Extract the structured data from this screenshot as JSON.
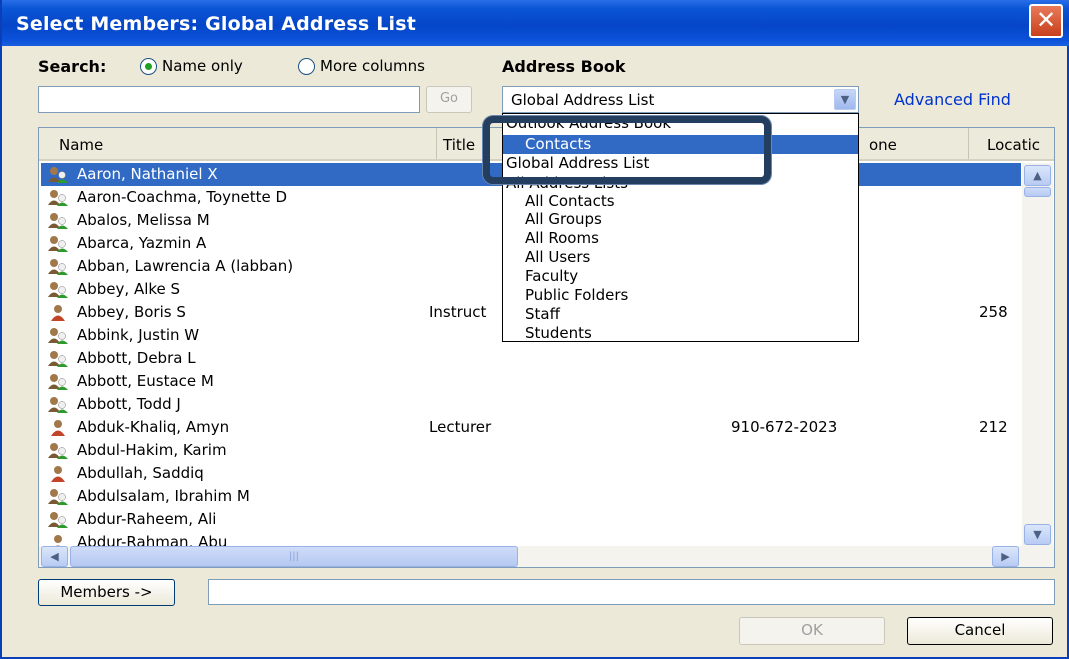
{
  "window": {
    "title": "Select Members: Global Address List",
    "close_label": "✕"
  },
  "search": {
    "label": "Search:",
    "options": [
      {
        "label": "Name only",
        "selected": true
      },
      {
        "label": "More columns",
        "selected": false
      }
    ],
    "value": "",
    "go_label": "Go"
  },
  "address_book": {
    "label": "Address Book",
    "selected": "Global Address List",
    "advanced_find": "Advanced Find",
    "options": [
      {
        "label": "Outlook Address Book",
        "indent": false,
        "highlighted": false
      },
      {
        "label": "Contacts",
        "indent": true,
        "highlighted": true
      },
      {
        "label": "Global Address List",
        "indent": false,
        "highlighted": false
      },
      {
        "label": "All Address Lists",
        "indent": false,
        "highlighted": false
      },
      {
        "label": "All Contacts",
        "indent": true,
        "highlighted": false
      },
      {
        "label": "All Groups",
        "indent": true,
        "highlighted": false
      },
      {
        "label": "All Rooms",
        "indent": true,
        "highlighted": false
      },
      {
        "label": "All Users",
        "indent": true,
        "highlighted": false
      },
      {
        "label": "Faculty",
        "indent": true,
        "highlighted": false
      },
      {
        "label": "Public Folders",
        "indent": true,
        "highlighted": false
      },
      {
        "label": "Staff",
        "indent": true,
        "highlighted": false
      },
      {
        "label": "Students",
        "indent": true,
        "highlighted": false
      }
    ]
  },
  "table": {
    "columns": [
      "Name",
      "Title",
      "one",
      "Locatic"
    ],
    "rows": [
      {
        "name": "Aaron, Nathaniel X",
        "title": "",
        "phone": "",
        "location": "",
        "icon": "contact-group",
        "selected": true
      },
      {
        "name": "Aaron-Coachma, Toynette D",
        "title": "",
        "phone": "",
        "location": "",
        "icon": "contact-group"
      },
      {
        "name": "Abalos, Melissa M",
        "title": "",
        "phone": "",
        "location": "",
        "icon": "contact-group"
      },
      {
        "name": "Abarca, Yazmin A",
        "title": "",
        "phone": "",
        "location": "",
        "icon": "contact-group"
      },
      {
        "name": "Abban, Lawrencia A (labban)",
        "title": "",
        "phone": "",
        "location": "",
        "icon": "contact-group"
      },
      {
        "name": "Abbey, Alke S",
        "title": "",
        "phone": "",
        "location": "",
        "icon": "contact-group"
      },
      {
        "name": "Abbey, Boris S",
        "title": "Instruct",
        "phone": "",
        "location": "258",
        "icon": "contact-person"
      },
      {
        "name": "Abbink, Justin W",
        "title": "",
        "phone": "",
        "location": "",
        "icon": "contact-group"
      },
      {
        "name": "Abbott, Debra L",
        "title": "",
        "phone": "",
        "location": "",
        "icon": "contact-group"
      },
      {
        "name": "Abbott, Eustace M",
        "title": "",
        "phone": "",
        "location": "",
        "icon": "contact-group"
      },
      {
        "name": "Abbott, Todd J",
        "title": "",
        "phone": "",
        "location": "",
        "icon": "contact-group"
      },
      {
        "name": "Abduk-Khaliq, Amyn",
        "title": "Lecturer",
        "phone": "910-672-2023",
        "location": "212",
        "icon": "contact-person"
      },
      {
        "name": "Abdul-Hakim, Karim",
        "title": "",
        "phone": "",
        "location": "",
        "icon": "contact-group"
      },
      {
        "name": "Abdullah, Saddiq",
        "title": "",
        "phone": "",
        "location": "",
        "icon": "contact-person"
      },
      {
        "name": "Abdulsalam, Ibrahim M",
        "title": "",
        "phone": "",
        "location": "",
        "icon": "contact-group"
      },
      {
        "name": "Abdur-Raheem, Ali",
        "title": "",
        "phone": "",
        "location": "",
        "icon": "contact-group"
      },
      {
        "name": "Abdur-Rahman, Abu",
        "title": "",
        "phone": "",
        "location": "",
        "icon": "contact-person"
      }
    ]
  },
  "members": {
    "button_label": "Members ->",
    "value": ""
  },
  "actions": {
    "ok_label": "OK",
    "cancel_label": "Cancel"
  },
  "colors": {
    "titlebar": "#0546c8",
    "selection": "#316ac5",
    "callout": "#243e60"
  }
}
